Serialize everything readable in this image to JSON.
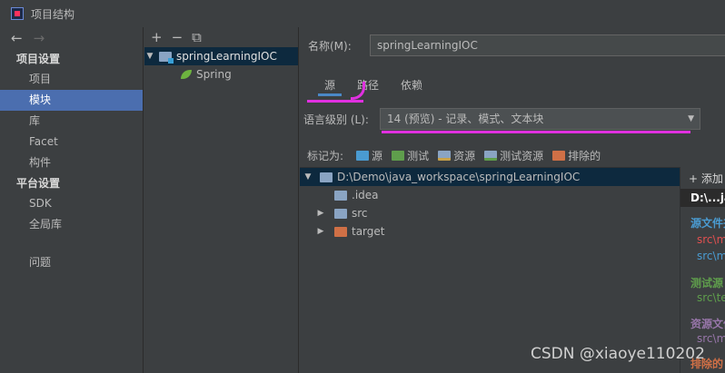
{
  "window": {
    "title": "项目结构"
  },
  "nav": {
    "back": "←",
    "forward": "→",
    "project_settings_header": "项目设置",
    "project_settings": [
      "项目",
      "模块",
      "库",
      "Facet",
      "构件"
    ],
    "selected_index": 1,
    "platform_settings_header": "平台设置",
    "platform_settings": [
      "SDK",
      "全局库"
    ],
    "problems": "问题"
  },
  "modules_toolbar": {
    "add": "+",
    "remove": "−",
    "copy": "⧉"
  },
  "modules_tree": {
    "module_name": "springLearningIOC",
    "facet": "Spring"
  },
  "module_detail": {
    "name_label": "名称(M):",
    "name_value": "springLearningIOC",
    "tabs": [
      "源",
      "路径",
      "依赖"
    ],
    "active_tab": 0,
    "language_level_label": "语言级别 (L):",
    "language_level_value": "14 (预览) - 记录、模式、文本块",
    "mark_as_label": "标记为:",
    "mark_as": [
      "源",
      "测试",
      "资源",
      "测试资源",
      "排除的"
    ]
  },
  "content_tree": {
    "root": "D:\\Demo\\java_workspace\\springLearningIOC",
    "children": [
      ".idea",
      "src",
      "target"
    ]
  },
  "content_roots": {
    "add_label": "+ 添加",
    "path": "D:\\...ja",
    "source_header": "源文件夹",
    "source_items": [
      "src\\m",
      "src\\m"
    ],
    "test_header": "测试源",
    "test_items": [
      "src\\te"
    ],
    "resource_header": "资源文件",
    "resource_items": [
      "src\\m"
    ],
    "excluded_header": "排除的"
  },
  "watermark": "CSDN @xiaoye110202",
  "colors": {
    "selection": "#4b6eaf",
    "tree_selection": "#0d293e",
    "source_folder": "#4a9bd1",
    "test_folder": "#5f9e4c",
    "excluded_folder": "#d07046",
    "annotation": "#e030e0"
  }
}
